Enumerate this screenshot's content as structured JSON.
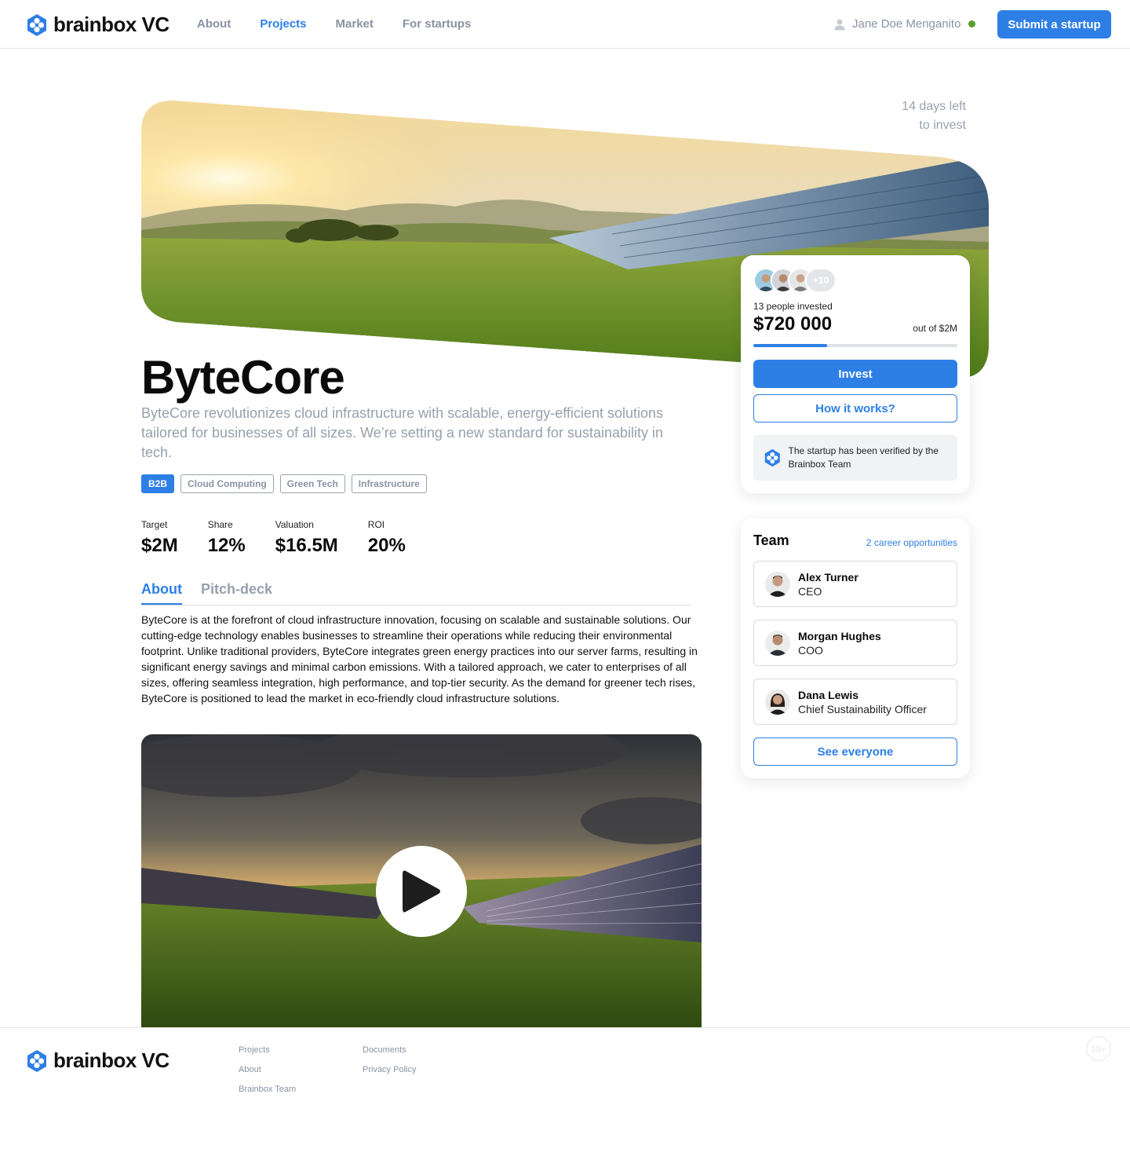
{
  "header": {
    "brand": "brainbox VC",
    "nav": [
      "About",
      "Projects",
      "Market",
      "For startups"
    ],
    "active_nav": "Projects",
    "user_name": "Jane Doe Menganito",
    "submit_label": "Submit a startup"
  },
  "project": {
    "days_left_line1": "14 days left",
    "days_left_line2": "to invest",
    "title": "ByteCore",
    "subtitle": "ByteCore revolutionizes cloud infrastructure with scalable, energy-efficient solutions tailored for businesses of all sizes. We’re setting a new standard for sustainability in tech.",
    "tags": [
      "B2B",
      "Cloud Computing",
      "Green Tech",
      "Infrastructure"
    ],
    "stats": [
      {
        "label": "Target",
        "value": "$2M"
      },
      {
        "label": "Share",
        "value": "12%"
      },
      {
        "label": "Valuation",
        "value": "$16.5M"
      },
      {
        "label": "ROI",
        "value": "20%"
      }
    ],
    "tabs": [
      "About",
      "Pitch-deck"
    ],
    "about": "ByteCore is at the forefront of cloud infrastructure innovation, focusing on scalable and sustainable solutions. Our cutting-edge technology enables businesses to streamline their operations while reducing their environmental footprint. Unlike traditional providers, ByteCore integrates green energy practices into our server farms, resulting in significant energy savings and minimal carbon emissions. With a tailored approach, we cater to enterprises of all sizes, offering seamless integration, high performance, and top-tier security. As the demand for greener tech rises, ByteCore is positioned to lead the market in eco-friendly cloud infrastructure solutions."
  },
  "invest": {
    "more_investors": "+10",
    "invested_label": "13 people invested",
    "amount": "$720 000",
    "out_of": "out of $2M",
    "progress": 0.36,
    "invest_label": "Invest",
    "how_label": "How it works?",
    "verified_text": "The startup has been verified by the Brainbox Team"
  },
  "team": {
    "title": "Team",
    "career": "2 career opportunities",
    "members": [
      {
        "name": "Alex Turner",
        "role": "CEO"
      },
      {
        "name": "Morgan Hughes",
        "role": "COO"
      },
      {
        "name": "Dana Lewis",
        "role": "Chief Sustainability Officer"
      }
    ],
    "see_label": "See everyone"
  },
  "footer": {
    "brand": "brainbox VC",
    "col1": [
      "Projects",
      "About",
      "Brainbox Team"
    ],
    "col2": [
      "Documents",
      "Privacy Policy"
    ],
    "age_badge": "18+"
  },
  "colors": {
    "accent": "#2d7fe6",
    "online": "#5aa02c",
    "muted": "#8a93a3"
  }
}
